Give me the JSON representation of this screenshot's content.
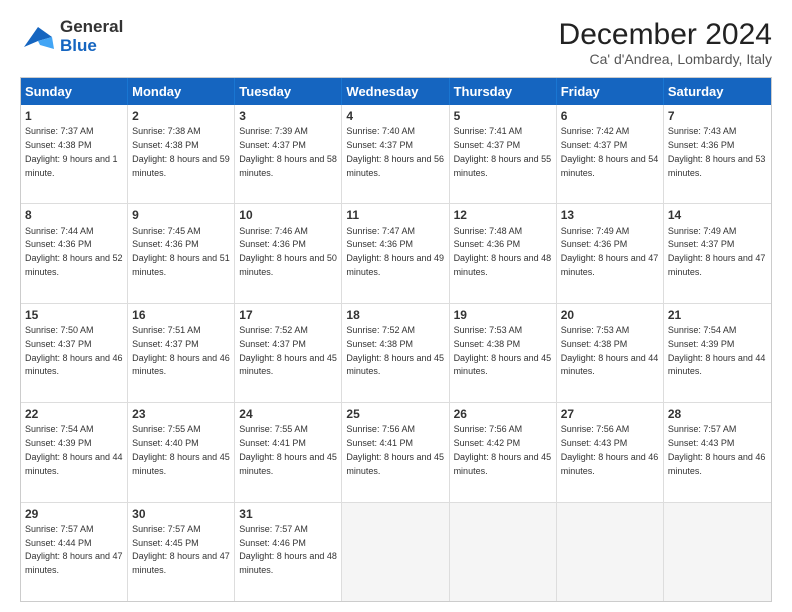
{
  "header": {
    "logo_general": "General",
    "logo_blue": "Blue",
    "month_title": "December 2024",
    "location": "Ca' d'Andrea, Lombardy, Italy"
  },
  "weekdays": [
    "Sunday",
    "Monday",
    "Tuesday",
    "Wednesday",
    "Thursday",
    "Friday",
    "Saturday"
  ],
  "rows": [
    [
      {
        "day": "1",
        "rise": "Sunrise: 7:37 AM",
        "set": "Sunset: 4:38 PM",
        "light": "Daylight: 9 hours and 1 minute."
      },
      {
        "day": "2",
        "rise": "Sunrise: 7:38 AM",
        "set": "Sunset: 4:38 PM",
        "light": "Daylight: 8 hours and 59 minutes."
      },
      {
        "day": "3",
        "rise": "Sunrise: 7:39 AM",
        "set": "Sunset: 4:37 PM",
        "light": "Daylight: 8 hours and 58 minutes."
      },
      {
        "day": "4",
        "rise": "Sunrise: 7:40 AM",
        "set": "Sunset: 4:37 PM",
        "light": "Daylight: 8 hours and 56 minutes."
      },
      {
        "day": "5",
        "rise": "Sunrise: 7:41 AM",
        "set": "Sunset: 4:37 PM",
        "light": "Daylight: 8 hours and 55 minutes."
      },
      {
        "day": "6",
        "rise": "Sunrise: 7:42 AM",
        "set": "Sunset: 4:37 PM",
        "light": "Daylight: 8 hours and 54 minutes."
      },
      {
        "day": "7",
        "rise": "Sunrise: 7:43 AM",
        "set": "Sunset: 4:36 PM",
        "light": "Daylight: 8 hours and 53 minutes."
      }
    ],
    [
      {
        "day": "8",
        "rise": "Sunrise: 7:44 AM",
        "set": "Sunset: 4:36 PM",
        "light": "Daylight: 8 hours and 52 minutes."
      },
      {
        "day": "9",
        "rise": "Sunrise: 7:45 AM",
        "set": "Sunset: 4:36 PM",
        "light": "Daylight: 8 hours and 51 minutes."
      },
      {
        "day": "10",
        "rise": "Sunrise: 7:46 AM",
        "set": "Sunset: 4:36 PM",
        "light": "Daylight: 8 hours and 50 minutes."
      },
      {
        "day": "11",
        "rise": "Sunrise: 7:47 AM",
        "set": "Sunset: 4:36 PM",
        "light": "Daylight: 8 hours and 49 minutes."
      },
      {
        "day": "12",
        "rise": "Sunrise: 7:48 AM",
        "set": "Sunset: 4:36 PM",
        "light": "Daylight: 8 hours and 48 minutes."
      },
      {
        "day": "13",
        "rise": "Sunrise: 7:49 AM",
        "set": "Sunset: 4:36 PM",
        "light": "Daylight: 8 hours and 47 minutes."
      },
      {
        "day": "14",
        "rise": "Sunrise: 7:49 AM",
        "set": "Sunset: 4:37 PM",
        "light": "Daylight: 8 hours and 47 minutes."
      }
    ],
    [
      {
        "day": "15",
        "rise": "Sunrise: 7:50 AM",
        "set": "Sunset: 4:37 PM",
        "light": "Daylight: 8 hours and 46 minutes."
      },
      {
        "day": "16",
        "rise": "Sunrise: 7:51 AM",
        "set": "Sunset: 4:37 PM",
        "light": "Daylight: 8 hours and 46 minutes."
      },
      {
        "day": "17",
        "rise": "Sunrise: 7:52 AM",
        "set": "Sunset: 4:37 PM",
        "light": "Daylight: 8 hours and 45 minutes."
      },
      {
        "day": "18",
        "rise": "Sunrise: 7:52 AM",
        "set": "Sunset: 4:38 PM",
        "light": "Daylight: 8 hours and 45 minutes."
      },
      {
        "day": "19",
        "rise": "Sunrise: 7:53 AM",
        "set": "Sunset: 4:38 PM",
        "light": "Daylight: 8 hours and 45 minutes."
      },
      {
        "day": "20",
        "rise": "Sunrise: 7:53 AM",
        "set": "Sunset: 4:38 PM",
        "light": "Daylight: 8 hours and 44 minutes."
      },
      {
        "day": "21",
        "rise": "Sunrise: 7:54 AM",
        "set": "Sunset: 4:39 PM",
        "light": "Daylight: 8 hours and 44 minutes."
      }
    ],
    [
      {
        "day": "22",
        "rise": "Sunrise: 7:54 AM",
        "set": "Sunset: 4:39 PM",
        "light": "Daylight: 8 hours and 44 minutes."
      },
      {
        "day": "23",
        "rise": "Sunrise: 7:55 AM",
        "set": "Sunset: 4:40 PM",
        "light": "Daylight: 8 hours and 45 minutes."
      },
      {
        "day": "24",
        "rise": "Sunrise: 7:55 AM",
        "set": "Sunset: 4:41 PM",
        "light": "Daylight: 8 hours and 45 minutes."
      },
      {
        "day": "25",
        "rise": "Sunrise: 7:56 AM",
        "set": "Sunset: 4:41 PM",
        "light": "Daylight: 8 hours and 45 minutes."
      },
      {
        "day": "26",
        "rise": "Sunrise: 7:56 AM",
        "set": "Sunset: 4:42 PM",
        "light": "Daylight: 8 hours and 45 minutes."
      },
      {
        "day": "27",
        "rise": "Sunrise: 7:56 AM",
        "set": "Sunset: 4:43 PM",
        "light": "Daylight: 8 hours and 46 minutes."
      },
      {
        "day": "28",
        "rise": "Sunrise: 7:57 AM",
        "set": "Sunset: 4:43 PM",
        "light": "Daylight: 8 hours and 46 minutes."
      }
    ],
    [
      {
        "day": "29",
        "rise": "Sunrise: 7:57 AM",
        "set": "Sunset: 4:44 PM",
        "light": "Daylight: 8 hours and 47 minutes."
      },
      {
        "day": "30",
        "rise": "Sunrise: 7:57 AM",
        "set": "Sunset: 4:45 PM",
        "light": "Daylight: 8 hours and 47 minutes."
      },
      {
        "day": "31",
        "rise": "Sunrise: 7:57 AM",
        "set": "Sunset: 4:46 PM",
        "light": "Daylight: 8 hours and 48 minutes."
      },
      {
        "day": "",
        "rise": "",
        "set": "",
        "light": ""
      },
      {
        "day": "",
        "rise": "",
        "set": "",
        "light": ""
      },
      {
        "day": "",
        "rise": "",
        "set": "",
        "light": ""
      },
      {
        "day": "",
        "rise": "",
        "set": "",
        "light": ""
      }
    ]
  ]
}
